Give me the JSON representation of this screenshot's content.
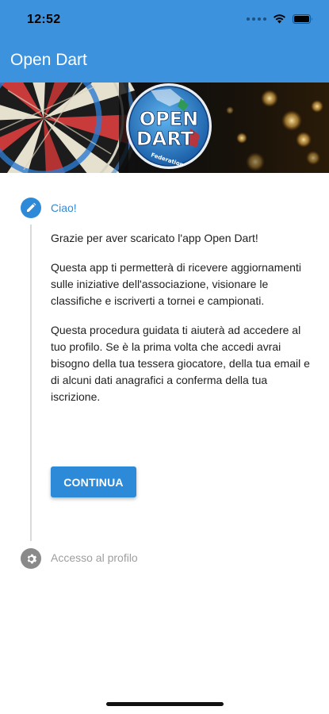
{
  "status_bar": {
    "time": "12:52",
    "icons": [
      "signal-dots-icon",
      "wifi-icon",
      "battery-icon"
    ]
  },
  "app_bar": {
    "title": "Open Dart",
    "color": "#3d92dd"
  },
  "banner": {
    "logo_lines": [
      "OPEN",
      "DART"
    ],
    "logo_small_text": "Federation"
  },
  "stepper": {
    "steps": [
      {
        "title": "Ciao!",
        "icon": "pencil-icon",
        "state": "active",
        "paragraphs": [
          "Grazie per aver scaricato l'app Open Dart!",
          "Questa app ti permetterà di ricevere aggiornamenti sulle iniziative dell'associazione, visionare le classifiche e iscriverti a tornei e campionati.",
          "Questa procedura guidata ti aiuterà ad accedere al tuo profilo. Se è la prima volta che accedi avrai bisogno della tua tessera giocatore, della tua email e di alcuni dati anagrafici a conferma della tua iscrizione."
        ],
        "button_label": "CONTINUA"
      },
      {
        "title": "Accesso al profilo",
        "icon": "gear-icon",
        "state": "inactive"
      }
    ]
  },
  "colors": {
    "accent": "#2d8ad9",
    "inactive": "#8a8a8a"
  }
}
